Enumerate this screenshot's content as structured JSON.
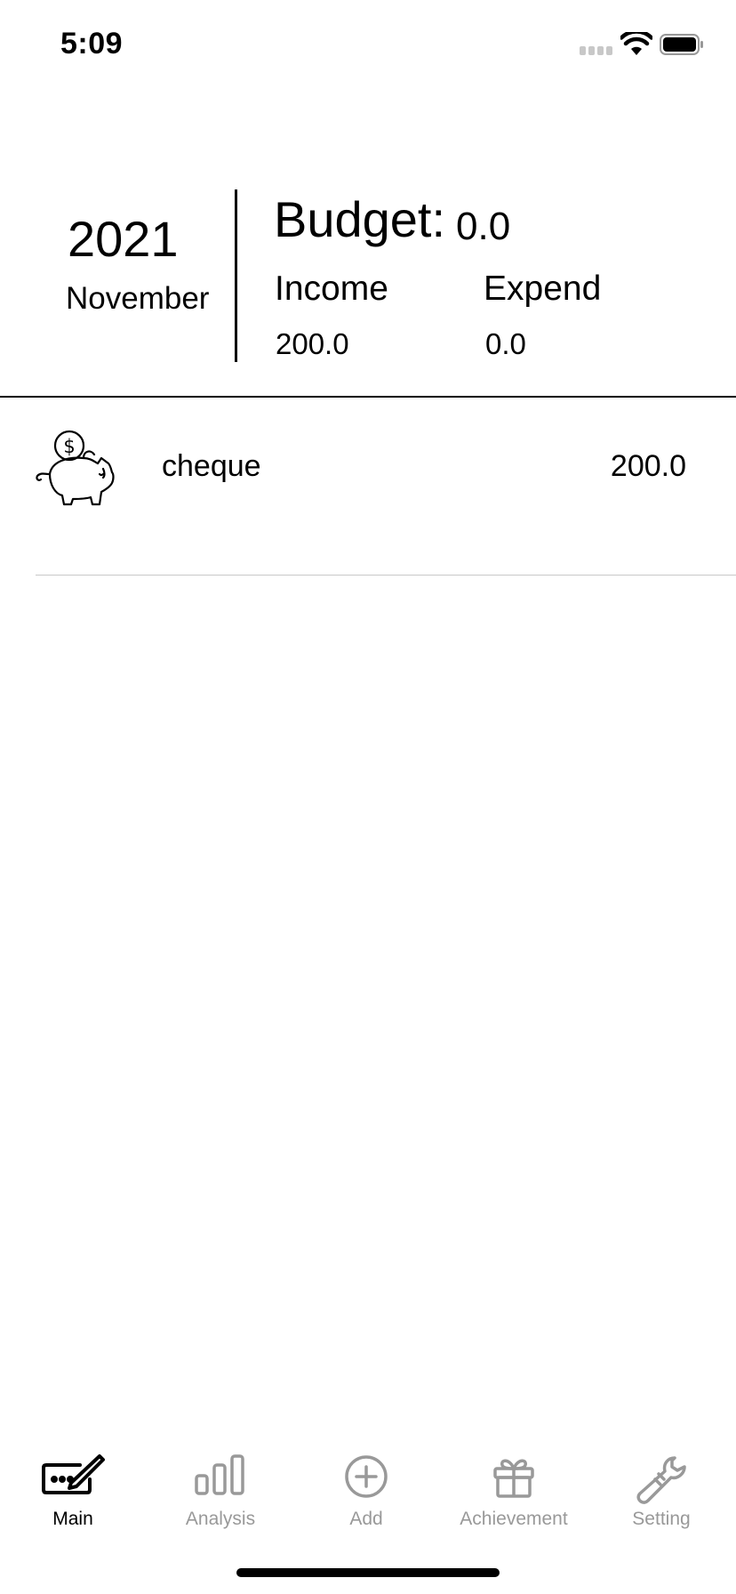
{
  "status_bar": {
    "time": "5:09"
  },
  "summary": {
    "year": "2021",
    "month": "November",
    "budget_label": "Budget:",
    "budget_value": "0.0",
    "income_label": "Income",
    "expend_label": "Expend",
    "income_value": "200.0",
    "expend_value": "0.0"
  },
  "records": [
    {
      "icon": "piggy-bank-icon",
      "name": "cheque",
      "amount": "200.0"
    }
  ],
  "tab_bar": {
    "active": "Main",
    "tabs": [
      {
        "label": "Main",
        "icon": "notebook-pen-icon"
      },
      {
        "label": "Analysis",
        "icon": "bar-chart-icon"
      },
      {
        "label": "Add",
        "icon": "plus-circle-icon"
      },
      {
        "label": "Achievement",
        "icon": "gift-icon"
      },
      {
        "label": "Setting",
        "icon": "wrench-icon"
      }
    ]
  },
  "colors": {
    "active": "#000000",
    "inactive": "#999999",
    "divider": "#c8c8c8"
  }
}
